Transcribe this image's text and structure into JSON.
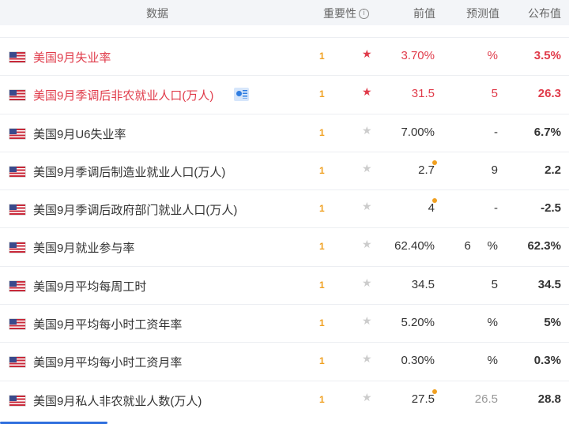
{
  "header": {
    "col_name": "数据",
    "col_importance": "重要性",
    "col_previous": "前值",
    "col_forecast": "预测值",
    "col_actual": "公布值"
  },
  "rows": [
    {
      "name": "美国9月失业率",
      "time": "1",
      "prev": "3.70%",
      "forecast": "%",
      "actual": "3.5%"
    },
    {
      "name": "美国9月季调后非农就业人口(万人)",
      "time": "1",
      "prev": "31.5",
      "forecast": "5",
      "actual": "26.3"
    },
    {
      "name": "美国9月U6失业率",
      "time": "1",
      "prev": "7.00%",
      "forecast": "-",
      "actual": "6.7%"
    },
    {
      "name": "美国9月季调后制造业就业人口(万人)",
      "time": "1",
      "prev": "2.7",
      "forecast": "9",
      "actual": "2.2"
    },
    {
      "name": "美国9月季调后政府部门就业人口(万人)",
      "time": "1",
      "prev": "4",
      "forecast": "-",
      "actual": "-2.5"
    },
    {
      "name": "美国9月就业参与率",
      "time": "1",
      "prev": "62.40%",
      "forecast": "6     %",
      "actual": "62.3%"
    },
    {
      "name": "美国9月平均每周工时",
      "time": "1",
      "prev": "34.5",
      "forecast": "5",
      "actual": "34.5"
    },
    {
      "name": "美国9月平均每小时工资年率",
      "time": "1",
      "prev": "5.20%",
      "forecast": "%",
      "actual": "5%"
    },
    {
      "name": "美国9月平均每小时工资月率",
      "time": "1",
      "prev": "0.30%",
      "forecast": "%",
      "actual": "0.3%"
    },
    {
      "name": "美国9月私人非农就业人数(万人)",
      "time": "1",
      "prev": "27.5",
      "forecast": "26.5",
      "actual": "28.8"
    }
  ],
  "colors": {
    "highlight": "#e03b4a",
    "time_accent": "#f0a020",
    "header_bg": "#f3f5f8",
    "tab_indicator": "#2f6fde"
  },
  "icons": {
    "flag": "us-flag-icon",
    "star": "star-icon",
    "info": "info-icon",
    "video_doc": "video-doc-icon"
  }
}
